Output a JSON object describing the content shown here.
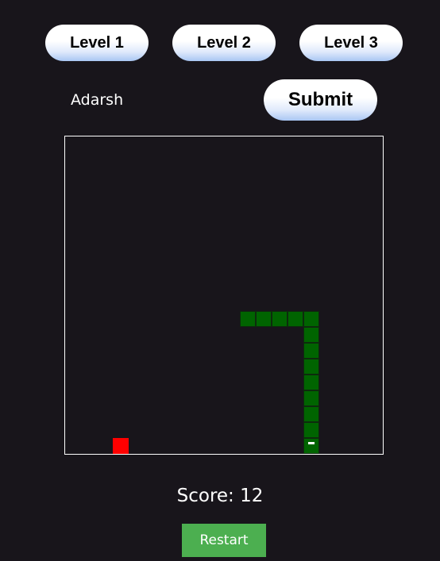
{
  "levels": [
    {
      "label": "Level 1"
    },
    {
      "label": "Level 2"
    },
    {
      "label": "Level 3"
    }
  ],
  "player": {
    "name": "Adarsh",
    "submit_label": "Submit"
  },
  "game": {
    "grid_cells": 20,
    "snake": [
      {
        "col": 15,
        "row": 19,
        "head": true
      },
      {
        "col": 15,
        "row": 18
      },
      {
        "col": 15,
        "row": 17
      },
      {
        "col": 15,
        "row": 16
      },
      {
        "col": 15,
        "row": 15
      },
      {
        "col": 15,
        "row": 14
      },
      {
        "col": 15,
        "row": 13
      },
      {
        "col": 15,
        "row": 12
      },
      {
        "col": 15,
        "row": 11
      },
      {
        "col": 11,
        "row": 11
      },
      {
        "col": 12,
        "row": 11
      },
      {
        "col": 13,
        "row": 11
      },
      {
        "col": 14,
        "row": 11
      }
    ],
    "food": {
      "col": 3,
      "row": 19
    },
    "colors": {
      "snake": "#006400",
      "food": "#ff0000",
      "background": "#18151b",
      "restart": "#4caf50"
    }
  },
  "score": {
    "text": "Score: 12"
  },
  "controls": {
    "restart_label": "Restart"
  }
}
